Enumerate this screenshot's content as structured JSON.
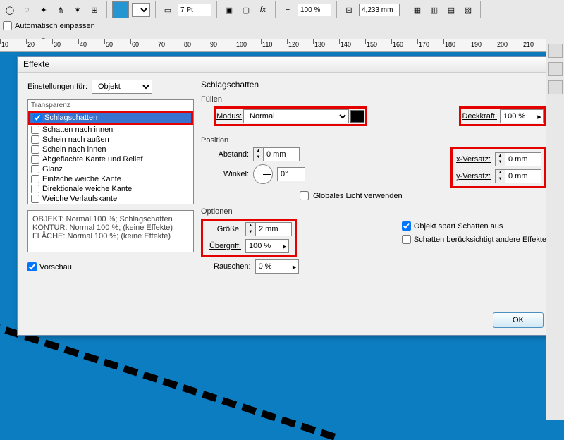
{
  "toolbar": {
    "stroke_pt": "7 Pt",
    "zoom": "100 %",
    "height": "4,233 mm",
    "auto_fit_label": "Automatisch einpassen"
  },
  "ruler_ticks": [
    10,
    20,
    30,
    40,
    50,
    60,
    70,
    80,
    90,
    100,
    110,
    120,
    130,
    140,
    150,
    160,
    170,
    180,
    190,
    200,
    210
  ],
  "dialog": {
    "title": "Effekte",
    "settings_for_label": "Einstellungen für:",
    "settings_for_value": "Objekt",
    "transparency_label": "Transparenz",
    "effects": [
      {
        "label": "Schlagschatten",
        "checked": true,
        "selected": true
      },
      {
        "label": "Schatten nach innen",
        "checked": false
      },
      {
        "label": "Schein nach außen",
        "checked": false
      },
      {
        "label": "Schein nach innen",
        "checked": false
      },
      {
        "label": "Abgeflachte Kante und Relief",
        "checked": false
      },
      {
        "label": "Glanz",
        "checked": false
      },
      {
        "label": "Einfache weiche Kante",
        "checked": false
      },
      {
        "label": "Direktionale weiche Kante",
        "checked": false
      },
      {
        "label": "Weiche Verlaufskante",
        "checked": false
      }
    ],
    "info_lines": [
      "OBJEKT: Normal 100 %; Schlagschatten",
      "KONTUR: Normal 100 %; (keine Effekte)",
      "FLÄCHE: Normal 100 %; (keine Effekte)"
    ],
    "preview_label": "Vorschau",
    "section_title": "Schlagschatten",
    "fill": {
      "title": "Füllen",
      "mode_label": "Modus:",
      "mode_value": "Normal",
      "opacity_label": "Deckkraft:",
      "opacity_value": "100 %"
    },
    "position": {
      "title": "Position",
      "distance_label": "Abstand:",
      "distance_value": "0 mm",
      "angle_label": "Winkel:",
      "angle_value": "0°",
      "x_label": "x-Versatz:",
      "x_value": "0 mm",
      "y_label": "y-Versatz:",
      "y_value": "0 mm",
      "global_light_label": "Globales Licht verwenden"
    },
    "options": {
      "title": "Optionen",
      "size_label": "Größe:",
      "size_value": "2 mm",
      "spread_label": "Übergriff:",
      "spread_value": "100 %",
      "noise_label": "Rauschen:",
      "noise_value": "0 %",
      "knockout_label": "Objekt spart Schatten aus",
      "honors_label": "Schatten berücksichtigt andere Effekte"
    },
    "ok_label": "OK"
  }
}
